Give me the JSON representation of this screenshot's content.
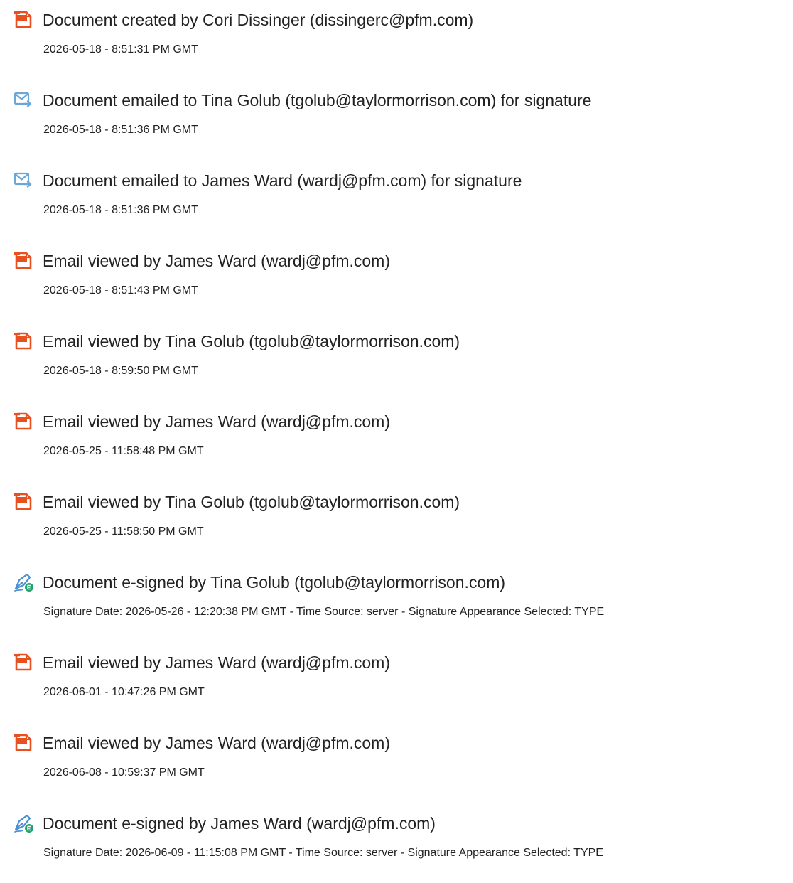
{
  "audit_events": [
    {
      "icon": "document-created-icon",
      "title": "Document created by Cori Dissinger (dissingerc@pfm.com)",
      "detail": "2026-05-18 - 8:51:31 PM GMT"
    },
    {
      "icon": "email-sent-icon",
      "title": "Document emailed to Tina Golub (tgolub@taylormorrison.com) for signature",
      "detail": "2026-05-18 - 8:51:36 PM GMT"
    },
    {
      "icon": "email-sent-icon",
      "title": "Document emailed to James Ward (wardj@pfm.com) for signature",
      "detail": "2026-05-18 - 8:51:36 PM GMT"
    },
    {
      "icon": "document-viewed-icon",
      "title": "Email viewed by James Ward (wardj@pfm.com)",
      "detail": "2026-05-18 - 8:51:43 PM GMT"
    },
    {
      "icon": "document-viewed-icon",
      "title": "Email viewed by Tina Golub (tgolub@taylormorrison.com)",
      "detail": "2026-05-18 - 8:59:50 PM GMT"
    },
    {
      "icon": "document-viewed-icon",
      "title": "Email viewed by James Ward (wardj@pfm.com)",
      "detail": "2026-05-25 - 11:58:48 PM GMT"
    },
    {
      "icon": "document-viewed-icon",
      "title": "Email viewed by Tina Golub (tgolub@taylormorrison.com)",
      "detail": "2026-05-25 - 11:58:50 PM GMT"
    },
    {
      "icon": "e-sign-pen-icon",
      "title": "Document e-signed by Tina Golub (tgolub@taylormorrison.com)",
      "detail": "Signature Date: 2026-05-26 - 12:20:38 PM GMT - Time Source: server - Signature Appearance Selected: TYPE"
    },
    {
      "icon": "document-viewed-icon",
      "title": "Email viewed by James Ward (wardj@pfm.com)",
      "detail": "2026-06-01 - 10:47:26 PM GMT"
    },
    {
      "icon": "document-viewed-icon",
      "title": "Email viewed by James Ward (wardj@pfm.com)",
      "detail": "2026-06-08 - 10:59:37 PM GMT"
    },
    {
      "icon": "e-sign-pen-icon",
      "title": "Document e-signed by James Ward (wardj@pfm.com)",
      "detail": "Signature Date: 2026-06-09 - 11:15:08 PM GMT - Time Source: server - Signature Appearance Selected: TYPE"
    }
  ],
  "colors": {
    "text": "#222222",
    "document_icon": "#e8501f",
    "email_icon": "#6aa7d8",
    "sign_pen_icon": "#4a8fd1",
    "sign_badge": "#20a36b"
  }
}
